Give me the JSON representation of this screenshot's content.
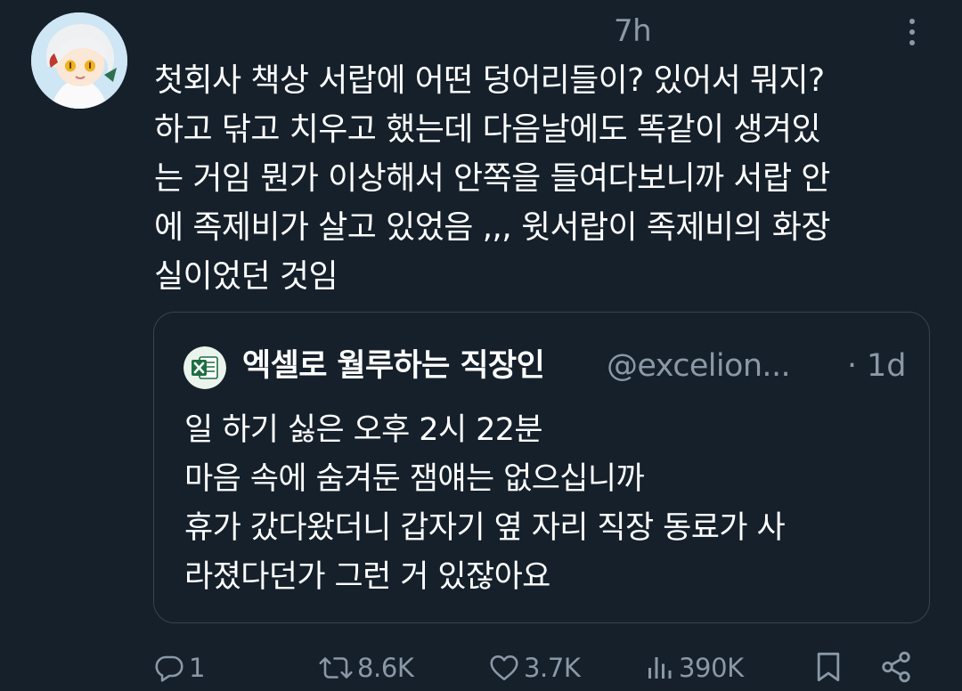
{
  "tweet": {
    "time": "7h",
    "text_lines": [
      "첫회사 책상 서랍에 어떤 덩어리들이? 있어서 뭐지?",
      "하고 닦고 치우고 했는데 다음날에도 똑같이 생겨있",
      "는 거임 뭔가 이상해서 안쪽을 들여다보니까 서랍 안",
      "에 족제비가 살고 있었음 ,,, 윗서랍이 족제비의 화장",
      "실이었던 것임"
    ]
  },
  "quote": {
    "name": "엑셀로 월루하는 직장인",
    "handle": "@excelion...",
    "separator": "·",
    "time": "1d",
    "text_lines": [
      "일 하기 싫은 오후 2시 22분",
      "마음 속에 숨겨둔 잼얘는 없으십니까",
      "휴가 갔다왔더니 갑자기 옆 자리 직장 동료가 사",
      "라졌다던가 그런 거 있잖아요"
    ]
  },
  "actions": {
    "reply_count": "1",
    "retweet_count": "8.6K",
    "like_count": "3.7K",
    "view_count": "390K"
  },
  "icons": {
    "more": "more-vertical-icon",
    "reply": "reply-icon",
    "retweet": "retweet-icon",
    "like": "heart-icon",
    "views": "views-icon",
    "bookmark": "bookmark-icon",
    "share": "share-icon"
  },
  "colors": {
    "background": "#15202b",
    "text": "#ffffff",
    "secondary_text": "#8b98a5",
    "border": "#38444d",
    "excel_green": "#1d6f42"
  }
}
